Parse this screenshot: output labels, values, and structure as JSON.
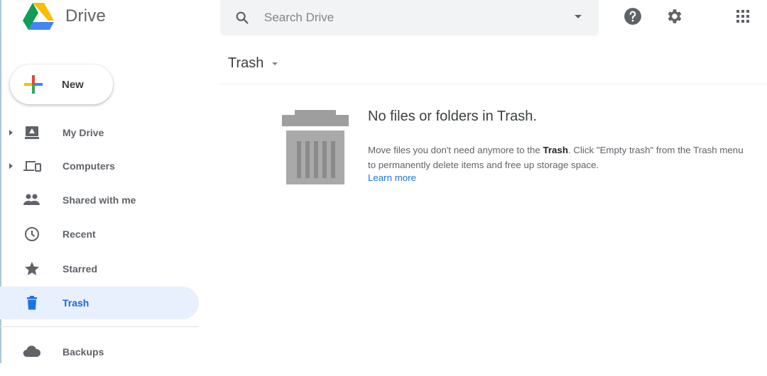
{
  "app": {
    "name": "Drive",
    "colors": {
      "accent": "#1967d2",
      "active_bg": "#e8f0fe",
      "link": "#1a73e8",
      "trash_gray": "#9e9e9e"
    }
  },
  "header": {
    "search": {
      "placeholder": "Search Drive",
      "value": "",
      "icon": "search-icon",
      "options_icon": "arrow-drop-down-icon"
    },
    "icons": [
      "help-icon",
      "settings-gear-icon",
      "apps-grid-icon"
    ]
  },
  "sidebar": {
    "new_button": {
      "label": "New",
      "icon": "plus-icon"
    },
    "items": [
      {
        "label": "My Drive",
        "icon": "my-drive-icon",
        "expandable": true
      },
      {
        "label": "Computers",
        "icon": "computers-icon",
        "expandable": true
      },
      {
        "label": "Shared with me",
        "icon": "people-icon",
        "expandable": false
      },
      {
        "label": "Recent",
        "icon": "clock-icon",
        "expandable": false
      },
      {
        "label": "Starred",
        "icon": "star-icon",
        "expandable": false
      },
      {
        "label": "Trash",
        "icon": "trash-icon",
        "expandable": false,
        "active": true
      },
      {
        "label": "Backups",
        "icon": "cloud-icon",
        "expandable": false
      }
    ]
  },
  "main": {
    "breadcrumb": {
      "label": "Trash",
      "menu_icon": "arrow-drop-down-icon"
    },
    "empty_state": {
      "illustration": "trash-can-illustration",
      "title": "No files or folders in Trash.",
      "desc_before": "Move files you don't need anymore to the ",
      "desc_bold": "Trash",
      "desc_after": ". Click \"Empty trash\" from the Trash menu to permanently delete items and free up storage space.",
      "link": "Learn more"
    }
  }
}
